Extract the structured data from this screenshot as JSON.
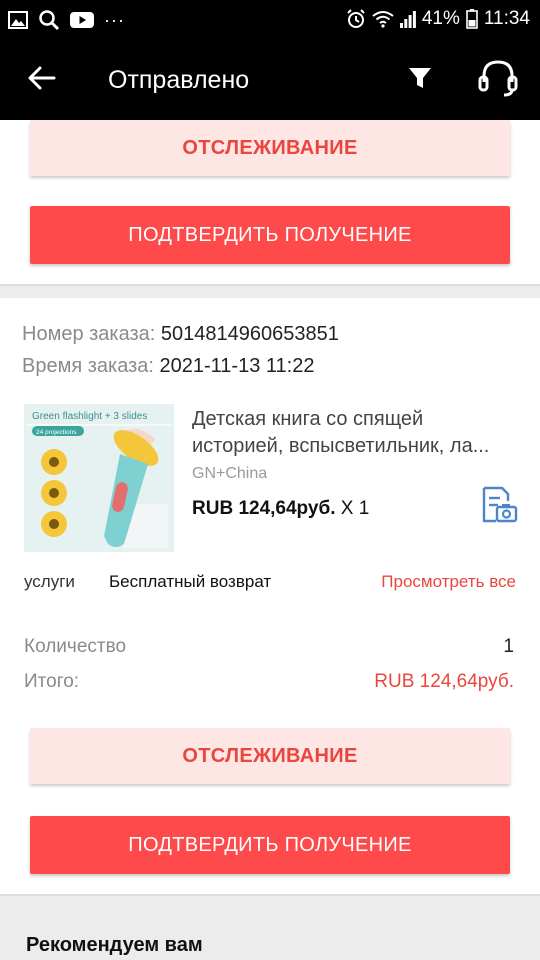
{
  "status_bar": {
    "battery": "41%",
    "time": "11:34",
    "dots": "···"
  },
  "app_bar": {
    "title": "Отправлено"
  },
  "top_card": {
    "track_label": "ОТСЛЕЖИВАНИЕ",
    "confirm_label": "ПОДТВЕРДИТЬ ПОЛУЧЕНИЕ"
  },
  "order": {
    "number_label": "Номер заказа:",
    "number_value": "5014814960653851",
    "time_label": "Время заказа:",
    "time_value": "2021-11-13 11:22"
  },
  "product": {
    "image_text_1": "Green flashlight + 3 slides",
    "image_text_2": "24 projections",
    "title_line_1": "Детская книга со спящей",
    "title_line_2": "историей, вспысветильник, ла...",
    "seller": "GN+China",
    "price": "RUB 124,64руб.",
    "quantity_mark": "X 1"
  },
  "services": {
    "label": "услуги",
    "value": "Бесплатный возврат",
    "view_all": "Просмотреть все"
  },
  "summary": {
    "qty_label": "Количество",
    "qty_value": "1",
    "total_label": "Итого:",
    "total_value": "RUB 124,64руб."
  },
  "bottom_actions": {
    "track_label": "ОТСЛЕЖИВАНИЕ",
    "confirm_label": "ПОДТВЕРДИТЬ ПОЛУЧЕНИЕ"
  },
  "recommend": {
    "title": "Рекомендуем вам"
  },
  "colors": {
    "accent_red": "#fe4a4a",
    "track_bg": "#fde6e4",
    "link_red": "#e9473e",
    "icon_blue": "#4a86c8"
  }
}
